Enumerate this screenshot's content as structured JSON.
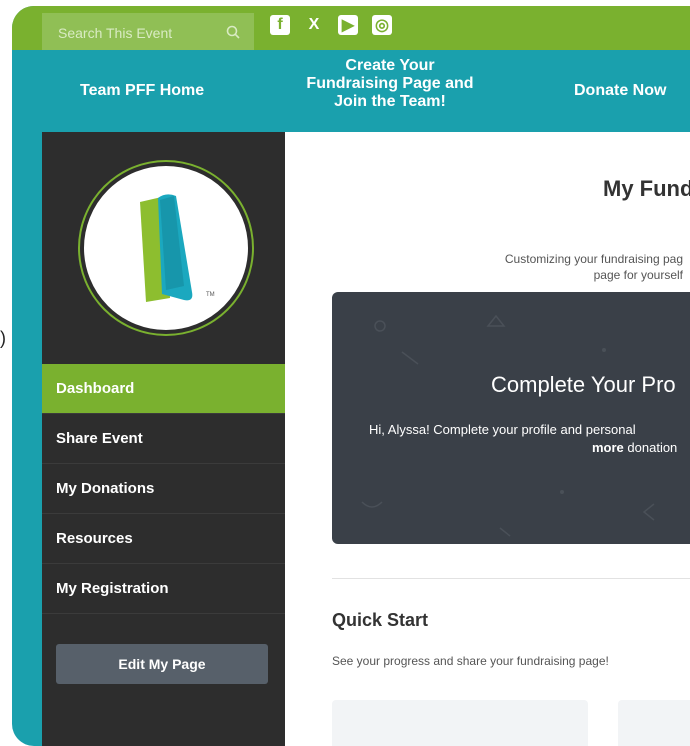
{
  "search": {
    "placeholder": "Search This Event"
  },
  "social": {
    "facebook": "f",
    "x": "X",
    "youtube": "▶",
    "instagram": "◎"
  },
  "nav": {
    "home": "Team PFF Home",
    "create_line1": "Create Your",
    "create_line2": "Fundraising Page and",
    "create_line3": "Join the Team!",
    "donate": "Donate Now"
  },
  "sidebar": {
    "items": [
      {
        "label": "Dashboard"
      },
      {
        "label": "Share Event"
      },
      {
        "label": "My Donations"
      },
      {
        "label": "Resources"
      },
      {
        "label": "My Registration"
      }
    ],
    "edit_button": "Edit My Page"
  },
  "main": {
    "title": "My Fund",
    "intro_line1": "Customizing your fundraising pag",
    "intro_line2": "page for yourself",
    "profile_card_title": "Complete Your Pro",
    "profile_card_text1": "Hi, Alyssa! Complete your profile and personal",
    "profile_card_text2_bold": "more",
    "profile_card_text2_rest": " donation",
    "quick_start_title": "Quick Start",
    "quick_start_sub": "See your progress and share your fundraising page!"
  },
  "colors": {
    "green": "#7ab12f",
    "teal": "#1aa0ad",
    "sidebar": "#2d2d2d",
    "card": "#3a4048"
  },
  "misc": {
    "left_paren": ")"
  }
}
